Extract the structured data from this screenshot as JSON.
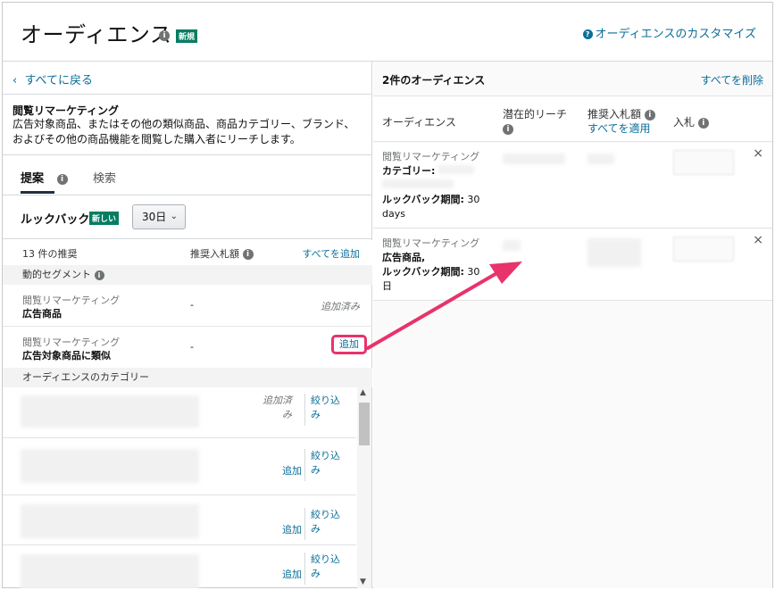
{
  "header": {
    "title": "オーディエンス",
    "new_badge": "新規",
    "customize_link": "オーディエンスのカスタマイズ"
  },
  "left": {
    "back_link": "すべてに戻る",
    "desc_title": "閲覧リマーケティング",
    "desc_text": "広告対象商品、またはその他の類似商品、商品カテゴリー、ブランド、およびその他の商品機能を閲覧した購入者にリーチします。",
    "tabs": [
      {
        "label": "提案"
      },
      {
        "label": "検索"
      }
    ],
    "lookback_label": "ルックバック",
    "lookback_badge": "新しい",
    "lookback_value": "30日",
    "table": {
      "count_label": "13 件の推奨",
      "bid_header": "推奨入札額",
      "add_all": "すべてを追加"
    },
    "dynamic_segment": "動的セグメント",
    "rows": [
      {
        "line1": "閲覧リマーケティング",
        "line2": "広告商品",
        "bid": "-",
        "action": "追加済み"
      },
      {
        "line1": "閲覧リマーケティング",
        "line2": "広告対象商品に類似",
        "bid": "-",
        "action": "追加"
      }
    ],
    "category_header": "オーディエンスのカテゴリー",
    "category_rows": [
      {
        "action_added": "追加済み",
        "refine": "絞り込み"
      },
      {
        "action": "追加",
        "refine": "絞り込み"
      },
      {
        "action": "追加",
        "refine": "絞り込み"
      },
      {
        "action": "追加",
        "refine": "絞り込み"
      }
    ]
  },
  "right": {
    "title": "2件のオーディエンス",
    "delete_all": "すべてを削除",
    "headers": {
      "audience": "オーディエンス",
      "reach": "潜在的リーチ",
      "bid": "推奨入札額",
      "apply_all": "すべてを適用",
      "input_bid": "入札"
    },
    "rows": [
      {
        "type": "閲覧リマーケティング",
        "label1": "カテゴリー:",
        "label2": "ルックバック期間:",
        "value2": "30",
        "value3": "days"
      },
      {
        "type": "閲覧リマーケティング",
        "label1": "広告商品,",
        "label2": "ルックバック期間:",
        "value2": "30",
        "value3": "日"
      }
    ]
  },
  "colors": {
    "link": "#0b6e99",
    "badge": "#067d62",
    "highlight": "#e8336b"
  }
}
